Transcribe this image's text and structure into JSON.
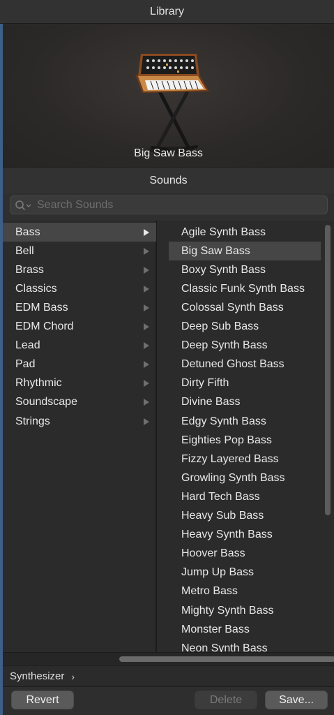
{
  "window": {
    "title": "Library"
  },
  "preview": {
    "patch_name": "Big Saw Bass"
  },
  "sounds": {
    "header": "Sounds",
    "search_placeholder": "Search Sounds"
  },
  "categories": [
    {
      "label": "Bass",
      "active": true
    },
    {
      "label": "Bell"
    },
    {
      "label": "Brass"
    },
    {
      "label": "Classics"
    },
    {
      "label": "EDM Bass"
    },
    {
      "label": "EDM Chord"
    },
    {
      "label": "Lead"
    },
    {
      "label": "Pad"
    },
    {
      "label": "Rhythmic"
    },
    {
      "label": "Soundscape"
    },
    {
      "label": "Strings"
    }
  ],
  "patches": [
    {
      "label": "Agile Synth Bass"
    },
    {
      "label": "Big Saw Bass",
      "selected": true
    },
    {
      "label": "Boxy Synth Bass"
    },
    {
      "label": "Classic Funk Synth Bass"
    },
    {
      "label": "Colossal Synth Bass"
    },
    {
      "label": "Deep Sub Bass"
    },
    {
      "label": "Deep Synth Bass"
    },
    {
      "label": "Detuned Ghost Bass"
    },
    {
      "label": "Dirty Fifth"
    },
    {
      "label": "Divine Bass"
    },
    {
      "label": "Edgy Synth Bass"
    },
    {
      "label": "Eighties Pop Bass"
    },
    {
      "label": "Fizzy Layered Bass"
    },
    {
      "label": "Growling Synth Bass"
    },
    {
      "label": "Hard Tech Bass"
    },
    {
      "label": "Heavy Sub Bass"
    },
    {
      "label": "Heavy Synth Bass"
    },
    {
      "label": "Hoover Bass"
    },
    {
      "label": "Jump Up Bass"
    },
    {
      "label": "Metro Bass"
    },
    {
      "label": "Mighty Synth Bass"
    },
    {
      "label": "Monster Bass"
    },
    {
      "label": "Neon Synth Bass"
    }
  ],
  "breadcrumb": {
    "label": "Synthesizer",
    "chevron": "›"
  },
  "footer": {
    "revert_label": "Revert",
    "delete_label": "Delete",
    "save_label": "Save..."
  },
  "icons": {
    "preview_image": "analog-synthesizer-on-stand-icon",
    "search": "search-icon",
    "category_arrow": "triangle-right-icon"
  },
  "colors": {
    "accent_frame": "#3d5f88",
    "selected_row": "#464646",
    "background": "#2b2b2b"
  }
}
